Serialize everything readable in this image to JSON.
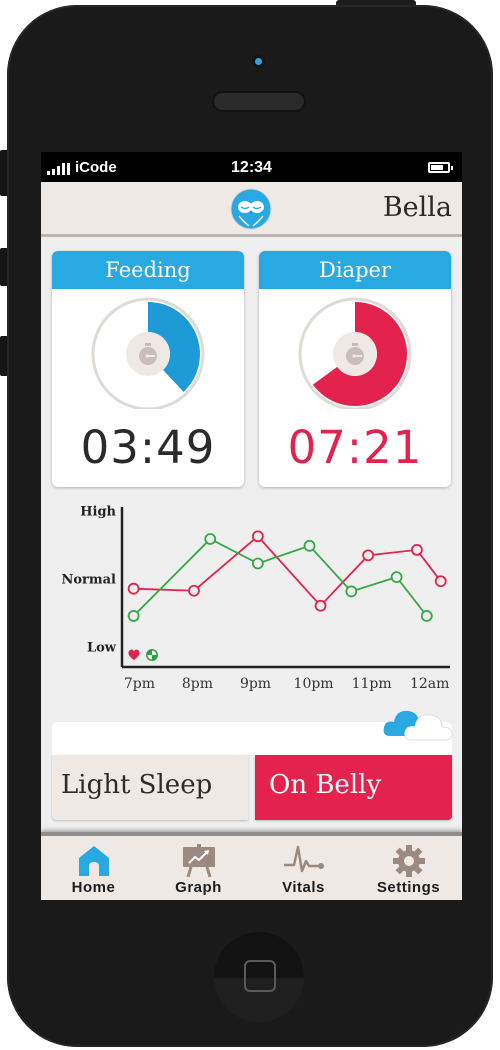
{
  "status_bar": {
    "carrier": "iCode",
    "time": "12:34",
    "battery_level": 0.6,
    "signal_bars": 4
  },
  "app_bar": {
    "logo": "owl-logo-icon",
    "baby_name": "Bella"
  },
  "cards": [
    {
      "id": "feeding",
      "title": "Feeding",
      "time": "03:49",
      "progress": 0.38,
      "color": "#1e9ad6",
      "time_color": "#2a2a2a",
      "icon": "stopwatch-icon"
    },
    {
      "id": "diaper",
      "title": "Diaper",
      "time": "07:21",
      "progress": 0.65,
      "color": "#e3234e",
      "time_color": "#e3234e",
      "icon": "stopwatch-icon"
    }
  ],
  "chart_data": {
    "type": "line",
    "title": "",
    "xlabel": "",
    "ylabel": "",
    "y_tick_labels": [
      "Low",
      "Normal",
      "High"
    ],
    "y_tick_values": [
      0,
      1,
      2
    ],
    "ylim": [
      -0.3,
      2.05
    ],
    "x_tick_labels": [
      "7pm",
      "8pm",
      "9pm",
      "10pm",
      "11pm",
      "12am"
    ],
    "x_tick_values": [
      0,
      1,
      2,
      3,
      4,
      5
    ],
    "xlim": [
      -0.3,
      5.35
    ],
    "grid": false,
    "legend": [
      {
        "name": "heart-rate",
        "icon": "heart-icon",
        "color": "#e3234e"
      },
      {
        "name": "breathing",
        "icon": "breathing-icon",
        "color": "#2ea043"
      }
    ],
    "series": [
      {
        "name": "heart-rate",
        "color": "#e3234e",
        "x": [
          -0.1,
          0.94,
          2.04,
          3.12,
          3.94,
          4.78,
          5.19
        ],
        "y": [
          0.85,
          0.82,
          1.62,
          0.6,
          1.34,
          1.42,
          0.96
        ]
      },
      {
        "name": "breathing",
        "color": "#35a845",
        "x": [
          -0.1,
          1.22,
          2.04,
          2.93,
          3.65,
          4.43,
          4.95
        ],
        "y": [
          0.45,
          1.58,
          1.22,
          1.48,
          0.81,
          1.02,
          0.45
        ]
      }
    ]
  },
  "activity": {
    "weather_icon": "cloud-icon",
    "sleep_state": "Light Sleep",
    "position": "On Belly",
    "position_color": "#e3234e"
  },
  "tabs": [
    {
      "label": "Home",
      "icon": "home-icon",
      "active": true
    },
    {
      "label": "Graph",
      "icon": "graph-icon",
      "active": false
    },
    {
      "label": "Vitals",
      "icon": "vitals-icon",
      "active": false
    },
    {
      "label": "Settings",
      "icon": "settings-icon",
      "active": false
    }
  ]
}
